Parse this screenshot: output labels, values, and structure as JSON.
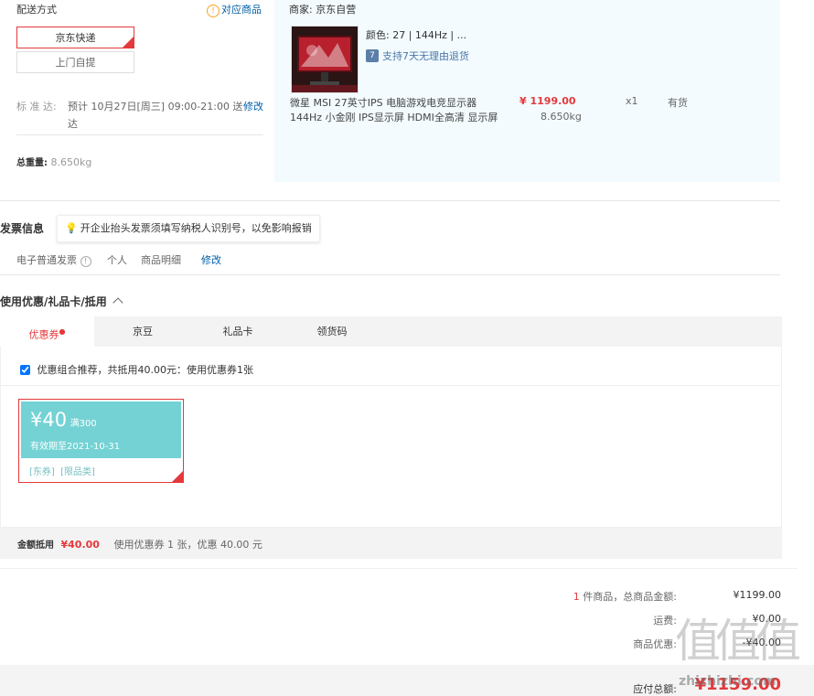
{
  "delivery": {
    "section_title": "配送方式",
    "related_goods_link": "对应商品",
    "options": [
      "京东快递",
      "上门自提"
    ],
    "std_label": "标 准 达:",
    "std_time_line1": "预计 10月27日[周三] 09:00-21:00 送",
    "std_time_line2": "达",
    "modify": "修改",
    "weight_label": "总重量:",
    "weight_value": "8.650kg"
  },
  "goods": {
    "merchant_label": "商家:",
    "merchant_name": "京东自营",
    "color_attr": "颜色: 27 | 144Hz | ...",
    "return_badge": "7",
    "return_text": "支持7天无理由退货",
    "name_line1": "微星 MSI 27英寸IPS 电脑游戏电竞显示器",
    "name_line2": "144Hz 小金刚 IPS显示屏 HDMI全高清 显示屏",
    "price": "¥ 1199.00",
    "weight": "8.650kg",
    "qty": "x1",
    "stock": "有货"
  },
  "invoice": {
    "title": "发票信息",
    "tip": "开企业抬头发票须填写纳税人识别号，以免影响报销",
    "type": "电子普通发票",
    "person": "个人",
    "content": "商品明细",
    "modify": "修改"
  },
  "discount": {
    "title": "使用优惠/礼品卡/抵用",
    "tabs": [
      "优惠券",
      "京豆",
      "礼品卡",
      "领货码"
    ],
    "combo_checked": true,
    "combo_text": "优惠组合推荐，共抵用40.00元：使用优惠券1张",
    "coupon": {
      "amount": "¥40",
      "condition": "满300",
      "valid": "有效期至2021-10-31",
      "tags": "[东券]  [限品类]"
    },
    "footer_label": "金额抵用",
    "footer_amount": "¥40.00",
    "footer_text": "使用优惠券 1 张，优惠 40.00 元"
  },
  "summary": {
    "count": "1",
    "count_text": "件商品，总商品金额:",
    "total_goods": "¥1199.00",
    "shipping_label": "运费:",
    "shipping": "¥0.00",
    "discount_label": "商品优惠:",
    "discount": "-¥40.00",
    "payable_label": "应付总额:",
    "payable": "¥1159.00"
  },
  "watermark": {
    "glyphs": "值值值",
    "site": "zhizhizhi.com"
  },
  "colors": {
    "accent": "#e4393c",
    "link": "#005ea7",
    "coupon": "#74d2d4"
  }
}
